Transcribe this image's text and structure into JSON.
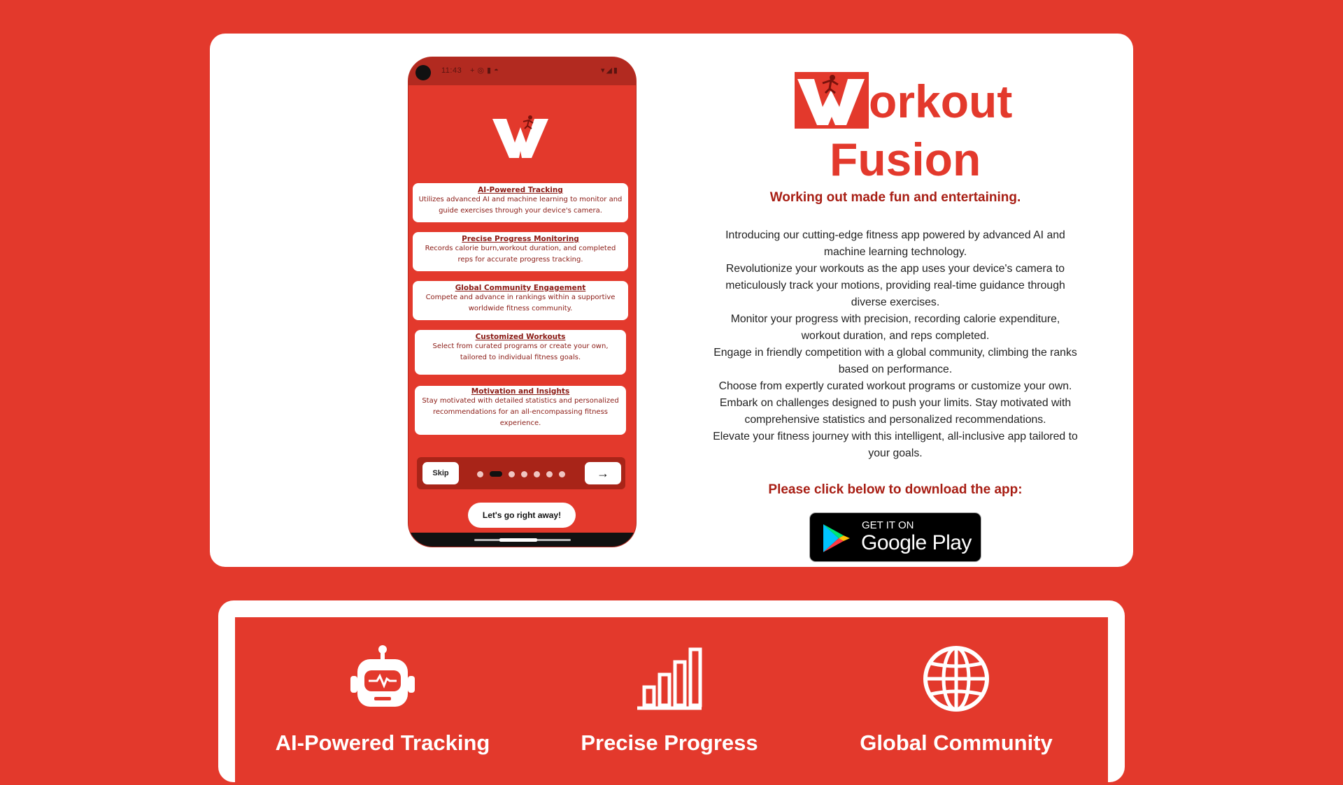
{
  "phone": {
    "status_time": "11:43",
    "cards": [
      {
        "title": "AI-Powered Tracking",
        "desc": "Utilizes advanced AI and machine learning to monitor and guide exercises through your device's camera."
      },
      {
        "title": "Precise Progress Monitoring",
        "desc": "Records calorie burn,workout duration, and completed reps for accurate progress tracking."
      },
      {
        "title": "Global Community Engagement",
        "desc": "Compete and advance in rankings within a supportive worldwide fitness community."
      },
      {
        "title": "Customized Workouts",
        "desc": "Select from curated programs or create your own, tailored to individual fitness goals."
      },
      {
        "title": "Motivation and Insights",
        "desc": "Stay motivated with detailed statistics and personalized recommendations for an all-encompassing fitness experience."
      }
    ],
    "skip_label": "Skip",
    "next_icon": "arrow-right-icon",
    "page_count": 7,
    "active_page": 2,
    "go_label": "Let's go right away!"
  },
  "brand": {
    "word1": "orkout",
    "word2": "Fusion",
    "tagline": "Working out made fun and entertaining."
  },
  "description": [
    "Introducing our cutting-edge fitness app powered by advanced AI and machine learning technology.",
    "Revolutionize your workouts as the app uses your device's camera to meticulously track your motions, providing real-time guidance through diverse exercises.",
    "Monitor your progress with precision, recording calorie expenditure, workout duration, and reps completed.",
    "Engage in friendly competition with a global community, climbing the ranks based on performance.",
    "Choose from expertly curated workout programs or customize your own.",
    "Embark on challenges designed to push your limits. Stay motivated with comprehensive statistics and personalized recommendations.",
    "Elevate your fitness journey with this intelligent, all-inclusive app tailored to your goals."
  ],
  "cta": "Please click below to download the app:",
  "google_play": {
    "line1": "GET IT ON",
    "line2": "Google Play"
  },
  "features": [
    {
      "title": "AI-Powered Tracking",
      "icon": "robot-icon"
    },
    {
      "title": "Precise Progress",
      "icon": "bar-chart-icon"
    },
    {
      "title": "Global Community",
      "icon": "globe-icon"
    }
  ],
  "colors": {
    "brand_red": "#e3392c",
    "dark_red": "#a81e14",
    "white": "#ffffff"
  }
}
